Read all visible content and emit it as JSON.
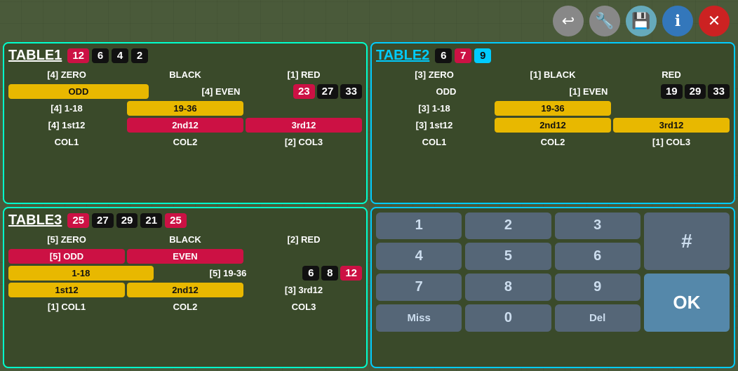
{
  "toolbar": {
    "back_label": "↩",
    "wrench_label": "🔧",
    "save_label": "💾",
    "info_label": "ℹ",
    "close_label": "✕"
  },
  "table1": {
    "title": "TABLE1",
    "header_badges": [
      {
        "value": "12",
        "color": "red"
      },
      {
        "value": "6",
        "color": "black"
      },
      {
        "value": "4",
        "color": "black"
      },
      {
        "value": "2",
        "color": "black"
      }
    ],
    "rows": [
      {
        "cells": [
          "[4] ZERO",
          "BLACK",
          "[1] RED"
        ]
      },
      {
        "cells": [
          "ODD",
          "[4] EVEN",
          "23",
          "27",
          "33"
        ]
      },
      {
        "cells": [
          "[4] 1-18",
          "19-36",
          ""
        ]
      },
      {
        "cells": [
          "[4] 1st12",
          "2nd12",
          "3rd12"
        ]
      },
      {
        "cells": [
          "COL1",
          "COL2",
          "[2] COL3"
        ]
      }
    ]
  },
  "table2": {
    "title": "TABLE2",
    "header_badges": [
      {
        "value": "6",
        "color": "black"
      },
      {
        "value": "7",
        "color": "red"
      },
      {
        "value": "9",
        "color": "cyan"
      }
    ],
    "rows": [
      {
        "cells": [
          "[3] ZERO",
          "[1] BLACK",
          "RED"
        ]
      },
      {
        "cells": [
          "ODD",
          "[1] EVEN",
          "19",
          "29",
          "33"
        ]
      },
      {
        "cells": [
          "[3] 1-18",
          "19-36",
          ""
        ]
      },
      {
        "cells": [
          "[3] 1st12",
          "2nd12",
          "3rd12"
        ]
      },
      {
        "cells": [
          "COL1",
          "COL2",
          "[1] COL3"
        ]
      }
    ]
  },
  "table3": {
    "title": "TABLE3",
    "header_badges": [
      {
        "value": "25",
        "color": "red"
      },
      {
        "value": "27",
        "color": "black"
      },
      {
        "value": "29",
        "color": "black"
      },
      {
        "value": "21",
        "color": "black"
      },
      {
        "value": "25",
        "color": "red"
      }
    ],
    "rows": [
      {
        "cells": [
          "[5] ZERO",
          "BLACK",
          "[2] RED"
        ]
      },
      {
        "cells": [
          "[5] ODD",
          "EVEN",
          ""
        ]
      },
      {
        "cells": [
          "1-18",
          "[5] 19-36",
          "6",
          "8",
          "12"
        ]
      },
      {
        "cells": [
          "1st12",
          "2nd12",
          "[3] 3rd12"
        ]
      },
      {
        "cells": [
          "[1] COL1",
          "COL2",
          "COL3"
        ]
      }
    ]
  },
  "numpad": {
    "buttons": [
      "1",
      "2",
      "3",
      "4",
      "5",
      "6",
      "7",
      "8",
      "9",
      "Miss",
      "0",
      "Del"
    ],
    "hash": "#",
    "ok": "OK"
  }
}
